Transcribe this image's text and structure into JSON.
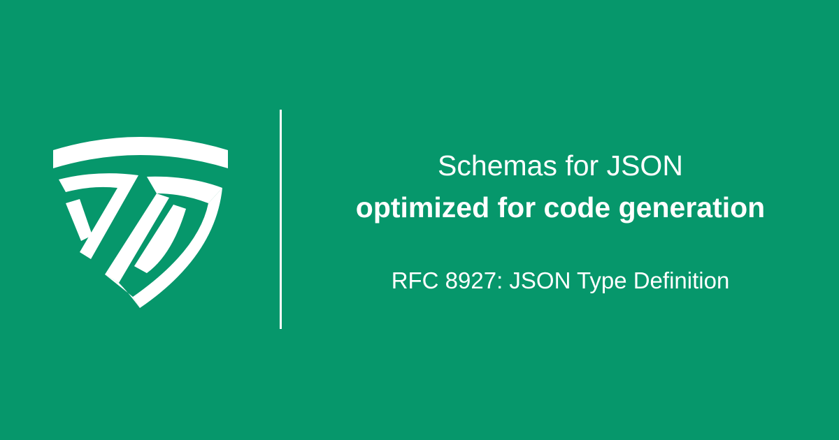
{
  "logo": {
    "icon": "jtd-shield-logo-icon",
    "color": "#ffffff"
  },
  "colors": {
    "background": "#06976b",
    "foreground": "#ffffff"
  },
  "headline": {
    "line1": "Schemas for JSON",
    "line2": "optimized for code generation"
  },
  "subtitle": "RFC 8927: JSON Type Definition"
}
